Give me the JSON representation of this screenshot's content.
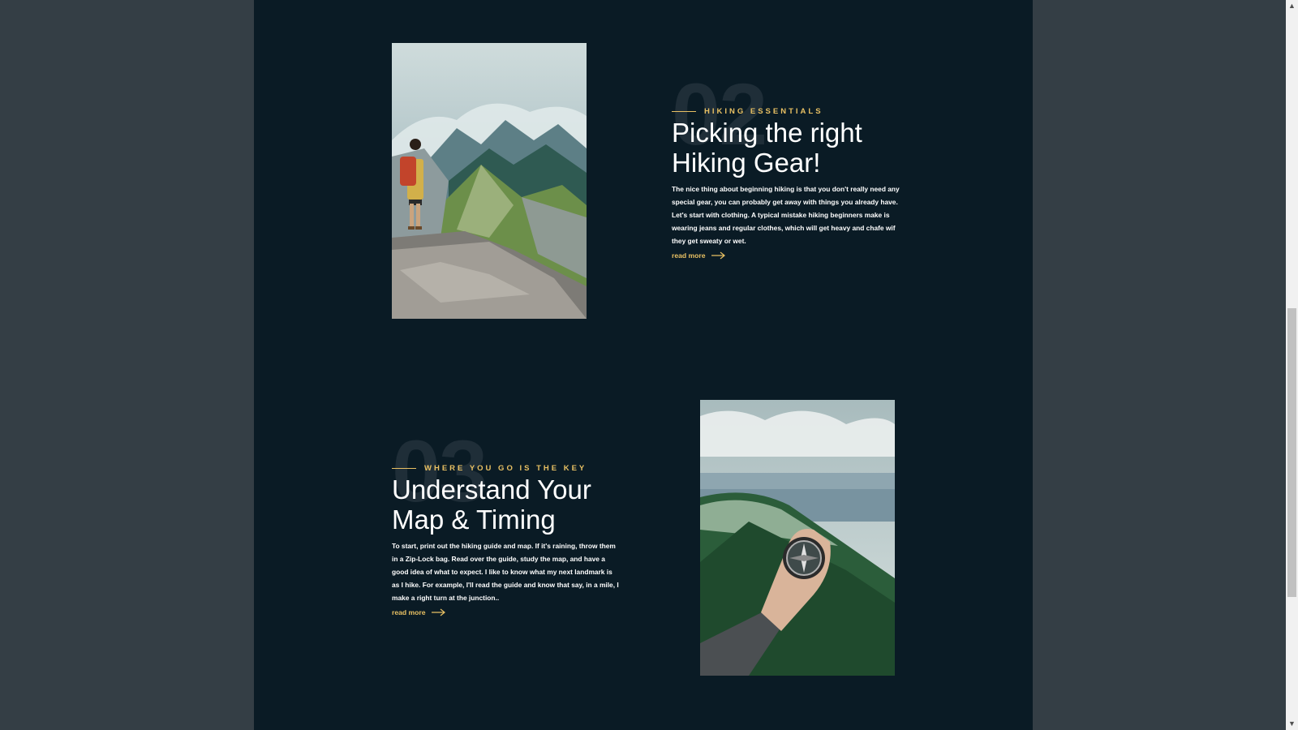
{
  "articles": [
    {
      "number": "02",
      "kicker": "HIKING ESSENTIALS",
      "title": "Picking the right Hiking Gear!",
      "body": "The nice thing about beginning hiking is that you don't really need any special gear, you can probably get away with things you already have. Let's start with clothing. A typical mistake hiking beginners make is wearing jeans and regular clothes, which will get heavy and chafe wif they get sweaty or wet.",
      "read_more": "read more",
      "image_icon": "hiker-on-mountain-photo"
    },
    {
      "number": "03",
      "kicker": "WHERE YOU GO IS THE KEY",
      "title": "Understand Your Map & Timing",
      "body": "To start, print out the hiking guide and map. If it's raining, throw them in a Zip-Lock bag. Read over the guide, study the map, and have a good idea of what to expect. I like to know what my next landmark is as I hike. For example, I'll read the guide and know that say, in a mile, I make a right turn at the junction..",
      "read_more": "read more",
      "image_icon": "compass-in-hand-photo"
    }
  ],
  "scrollbar": {
    "up_icon": "chevron-up-icon",
    "down_icon": "chevron-down-icon",
    "position_fraction": 0.42
  },
  "colors": {
    "accent": "#e8c063",
    "page_bg": "#0a1b25",
    "outer_bg": "#343e45"
  }
}
